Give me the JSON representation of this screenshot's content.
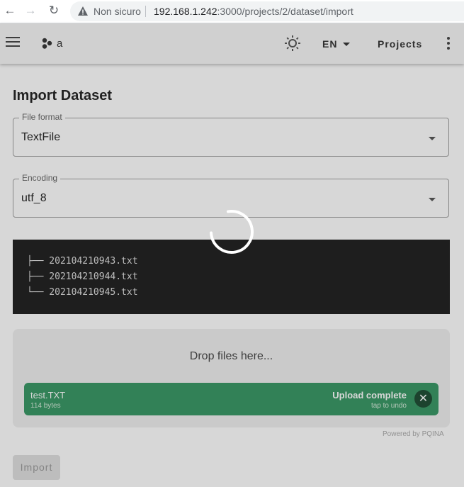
{
  "browser": {
    "back_icon": "arrow-left-icon",
    "forward_icon": "arrow-right-icon",
    "reload_icon": "reload-icon",
    "security_label": "Non sicuro",
    "url_host": "192.168.1.242",
    "url_rest": ":3000/projects/2/dataset/import"
  },
  "appbar": {
    "menu_icon": "hamburger-icon",
    "logo_text": "a",
    "theme_icon": "sun-icon",
    "language": "EN",
    "projects_label": "Projects",
    "more_icon": "kebab-icon"
  },
  "page": {
    "title": "Import Dataset",
    "file_format": {
      "label": "File format",
      "value": "TextFile"
    },
    "encoding": {
      "label": "Encoding",
      "value": "utf_8"
    },
    "file_tree": [
      "├── 202104210943.txt",
      "├── 202104210944.txt",
      "└── 202104210945.txt"
    ],
    "dropzone": {
      "label": "Drop files here...",
      "file": {
        "name": "test.TXT",
        "size": "114 bytes",
        "status": "Upload complete",
        "undo": "tap to undo"
      },
      "powered_by": "Powered by PQINA"
    },
    "import_button": "Import"
  },
  "colors": {
    "upload_success": "#369763",
    "tree_bg": "#1e1e1e",
    "appbar_bg": "#f7f7f7"
  }
}
